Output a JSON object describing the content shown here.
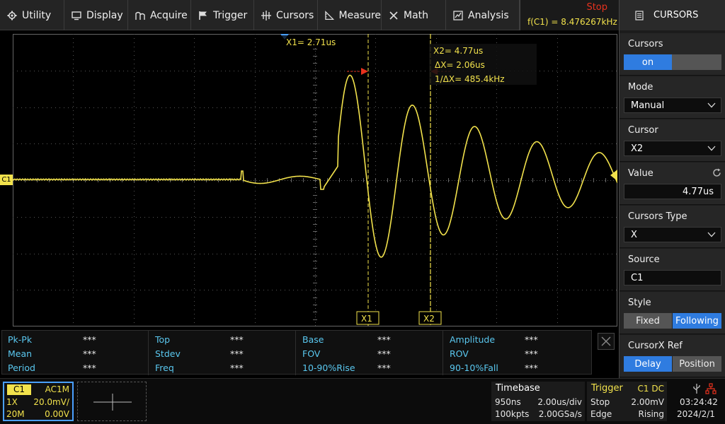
{
  "menu": {
    "items": [
      {
        "label": "Utility",
        "icon": "gear-icon"
      },
      {
        "label": "Display",
        "icon": "monitor-icon"
      },
      {
        "label": "Acquire",
        "icon": "acquire-icon"
      },
      {
        "label": "Trigger",
        "icon": "flag-icon"
      },
      {
        "label": "Cursors",
        "icon": "crosshair-icon"
      },
      {
        "label": "Measure",
        "icon": "ruler-icon"
      },
      {
        "label": "Math",
        "icon": "math-icon"
      },
      {
        "label": "Analysis",
        "icon": "analysis-icon"
      }
    ]
  },
  "status": {
    "run_state": "Stop",
    "frequency": "f(C1) = 8.476267kHz",
    "run_color": "#e8321e"
  },
  "waveform": {
    "channel_marker": "C1",
    "trace_color": "#f2e24c",
    "cursor_readout": {
      "x1": "X1= 2.71us",
      "x2": "X2= 4.77us",
      "dx": "ΔX= 2.06us",
      "inv_dx": "1/ΔX= 485.4kHz"
    },
    "cursor_tags": {
      "x1": "X1",
      "x2": "X2"
    }
  },
  "measure": {
    "rows": [
      [
        {
          "label": "Pk-Pk",
          "value": "***"
        },
        {
          "label": "Top",
          "value": "***"
        },
        {
          "label": "Base",
          "value": "***"
        },
        {
          "label": "Amplitude",
          "value": "***"
        }
      ],
      [
        {
          "label": "Mean",
          "value": "***"
        },
        {
          "label": "Stdev",
          "value": "***"
        },
        {
          "label": "FOV",
          "value": "***"
        },
        {
          "label": "ROV",
          "value": "***"
        }
      ],
      [
        {
          "label": "Period",
          "value": "***"
        },
        {
          "label": "Freq",
          "value": "***"
        },
        {
          "label": "10-90%Rise",
          "value": "***"
        },
        {
          "label": "90-10%Fall",
          "value": "***"
        }
      ]
    ]
  },
  "channel1": {
    "tag": "C1",
    "coupling": "AC1M",
    "probe": "1X",
    "scale": "20.0mV/",
    "bw": "20M",
    "offset": "0.00V"
  },
  "timebase": {
    "title": "Timebase",
    "delay": "950ns",
    "scale": "2.00us/div",
    "points": "100kpts",
    "rate": "2.00GSa/s"
  },
  "trigger": {
    "title": "Trigger",
    "source": "C1 DC",
    "mode": "Stop",
    "level": "2.00mV",
    "type": "Edge",
    "slope": "Rising"
  },
  "system": {
    "time": "03:24:42",
    "date": "2024/2/1"
  },
  "panel": {
    "title": "CURSORS",
    "cursors": {
      "label": "Cursors",
      "on": "on"
    },
    "mode": {
      "label": "Mode",
      "value": "Manual"
    },
    "cursor": {
      "label": "Cursor",
      "value": "X2"
    },
    "value": {
      "label": "Value",
      "value": "4.77us"
    },
    "cursors_type": {
      "label": "Cursors Type",
      "value": "X"
    },
    "source": {
      "label": "Source",
      "value": "C1"
    },
    "style": {
      "label": "Style",
      "fixed": "Fixed",
      "following": "Following"
    },
    "cursorx_ref": {
      "label": "CursorX Ref",
      "delay": "Delay",
      "position": "Position"
    }
  }
}
